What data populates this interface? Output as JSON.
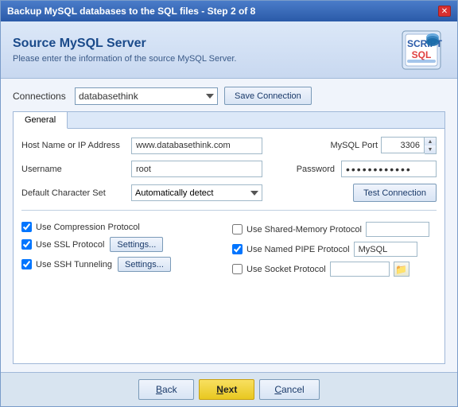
{
  "window": {
    "title": "Backup MySQL databases to the SQL files - Step 2 of 8",
    "close_label": "✕"
  },
  "header": {
    "title": "Source MySQL Server",
    "subtitle": "Please enter the information of the source MySQL Server."
  },
  "connections": {
    "label": "Connections",
    "selected_value": "databasethink",
    "options": [
      "databasethink"
    ],
    "save_button": "Save Connection"
  },
  "tabs": [
    {
      "id": "general",
      "label": "General",
      "active": true
    }
  ],
  "form": {
    "host_label": "Host Name or IP Address",
    "host_value": "www.databasethink.com",
    "port_label": "MySQL Port",
    "port_value": "3306",
    "username_label": "Username",
    "username_value": "root",
    "password_label": "Password",
    "password_value": "••••••••••",
    "charset_label": "Default Character Set",
    "charset_value": "Automatically detect",
    "charset_options": [
      "Automatically detect"
    ],
    "test_connection_button": "Test Connection"
  },
  "protocols": {
    "compression": {
      "label": "Use Compression Protocol",
      "checked": true
    },
    "shared_memory": {
      "label": "Use Shared-Memory Protocol",
      "checked": false,
      "input_value": ""
    },
    "ssl": {
      "label": "Use SSL Protocol",
      "checked": true,
      "settings_button": "Settings..."
    },
    "named_pipe": {
      "label": "Use Named PIPE Protocol",
      "checked": true,
      "input_value": "MySQL"
    },
    "ssh": {
      "label": "Use SSH Tunneling",
      "checked": true,
      "settings_button": "Settings..."
    },
    "socket": {
      "label": "Use Socket Protocol",
      "checked": false,
      "folder_icon": "📁"
    }
  },
  "footer": {
    "back_button": "Back",
    "next_button": "Next",
    "cancel_button": "Cancel"
  }
}
